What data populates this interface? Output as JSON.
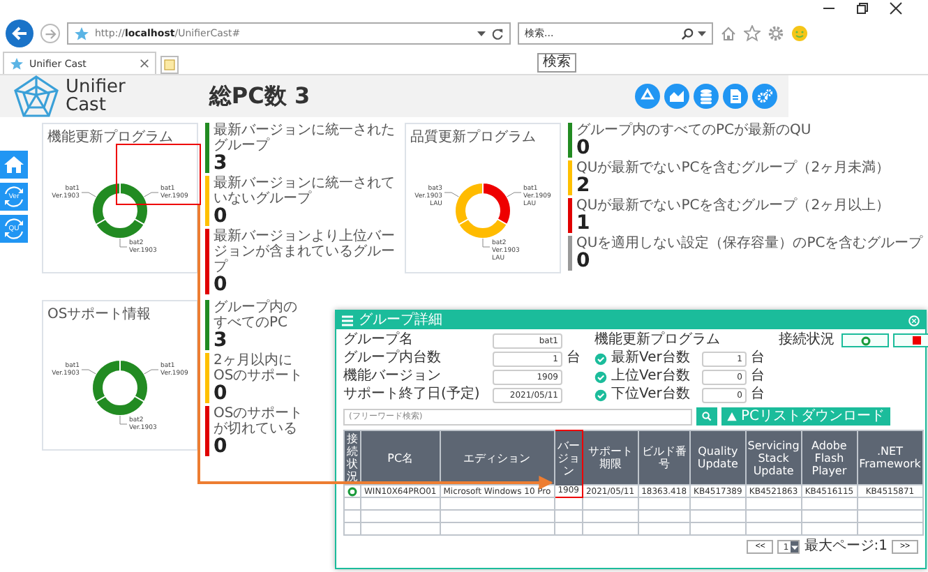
{
  "browser": {
    "url": "http://**localhost**/UnifierCast#",
    "search": {
      "value": "検索...",
      "tooltip": "検索"
    },
    "tabs": [
      {
        "label": "Unifier Cast",
        "selected": true
      }
    ]
  },
  "app": {
    "logo": [
      "Unifier",
      "Cast"
    ],
    "title": "総PC数 3"
  },
  "sidebar": {
    "items": [
      {
        "kind": "home"
      },
      {
        "kind": "cycle",
        "label": "Ver"
      },
      {
        "kind": "cycle",
        "label": "QU"
      }
    ]
  },
  "panels": [
    {
      "title": "機能更新プログラム",
      "highlighted": true,
      "slices": [
        {
          "color": "#228b22",
          "label": [
            "bat1",
            "Ver.1909"
          ]
        },
        {
          "color": "#228b22",
          "label": [
            "bat2",
            "Ver.1903"
          ]
        },
        {
          "color": "#228b22",
          "label": [
            "bat1",
            "Ver.1903"
          ]
        }
      ],
      "stats": [
        {
          "label": "最新バージョンに統一されたグループ",
          "value": "3",
          "color": "#228b22"
        },
        {
          "label": "最新バージョンに統一されていないグループ",
          "value": "0",
          "color": "#ffc000"
        },
        {
          "label": "最新バージョンより上位バージョンが含まれているグループ",
          "value": "0",
          "color": "#e00000"
        }
      ]
    },
    {
      "title": "品質更新プログラム",
      "highlighted": false,
      "slices": [
        {
          "color": "#ee0000",
          "label": [
            "bat1",
            "Ver.1909",
            "LAU"
          ]
        },
        {
          "color": "#ffbb00",
          "label": [
            "bat2",
            "Ver.1903",
            "LAU"
          ]
        },
        {
          "color": "#ffbb00",
          "label": [
            "bat3",
            "Ver.1903",
            "LAU"
          ]
        }
      ],
      "stats": [
        {
          "label": "グループ内のすべてのPCが最新のQU",
          "value": "0",
          "color": "#228b22"
        },
        {
          "label": "QUが最新でないPCを含むグループ（2ヶ月未満）",
          "value": "2",
          "color": "#ffc000"
        },
        {
          "label": "QUが最新でないPCを含むグループ（2ヶ月以上）",
          "value": "1",
          "color": "#e00000"
        },
        {
          "label": "QUを適用しない設定（保存容量）のPCを含むグループ",
          "value": "0",
          "color": "#999999"
        }
      ]
    },
    {
      "title": "OSサポート情報",
      "highlighted": false,
      "slices": [
        {
          "color": "#228b22",
          "label": [
            "bat1",
            "Ver.1909"
          ]
        },
        {
          "color": "#228b22",
          "label": [
            "bat2",
            "Ver.1903"
          ]
        },
        {
          "color": "#228b22",
          "label": [
            "bat1",
            "Ver.1903"
          ]
        }
      ],
      "stats": [
        {
          "label": "グループ内のすべてのPC",
          "value": "3",
          "color": "#228b22"
        },
        {
          "label": "2ヶ月以内にOSのサポート",
          "value": "0",
          "color": "#ffc000"
        },
        {
          "label": "OSのサポートが切れている",
          "value": "0",
          "color": "#e00000"
        }
      ]
    }
  ],
  "dialog": {
    "title": "グループ詳細",
    "fields": [
      {
        "label": "グループ名",
        "value": "bat1"
      },
      {
        "label": "グループ内台数",
        "value": "1",
        "unit": "台"
      },
      {
        "label": "機能バージョン",
        "value": "1909"
      },
      {
        "label": "サポート終了日(予定)",
        "value": "2021/05/11"
      }
    ],
    "program": {
      "title": "機能更新プログラム",
      "counts": [
        {
          "label": "最新Ver台数",
          "value": "1",
          "unit": "台"
        },
        {
          "label": "上位Ver台数",
          "value": "0",
          "unit": "台"
        },
        {
          "label": "下位Ver台数",
          "value": "0",
          "unit": "台"
        }
      ]
    },
    "connection": {
      "label": "接続状況",
      "toggles": [
        {
          "kind": "online"
        },
        {
          "kind": "offline"
        }
      ]
    },
    "search": {
      "placeholder": "(フリーワード検索)"
    },
    "download": "PCリストダウンロード",
    "table": {
      "columns": [
        {
          "label": "接続状況",
          "highlighted": false
        },
        {
          "label": "PC名",
          "highlighted": false
        },
        {
          "label": "エディション",
          "highlighted": false
        },
        {
          "label": "バージョン",
          "highlighted": true
        },
        {
          "label": "サポート期限",
          "highlighted": false
        },
        {
          "label": "ビルド番号",
          "highlighted": false
        },
        {
          "label": "Quality Update",
          "highlighted": false
        },
        {
          "label": "Servicing Stack Update",
          "highlighted": false
        },
        {
          "label": "Adobe Flash Player",
          "highlighted": false
        },
        {
          "label": ".NET Framework",
          "highlighted": false
        }
      ],
      "rows": [
        {
          "connected": true,
          "cells": [
            "",
            "WIN10X64PRO01",
            "Microsoft Windows 10 Pro",
            "1909",
            "2021/05/11",
            "18363.418",
            "KB4517389",
            "KB4521863",
            "KB4516115",
            "KB4515871"
          ]
        }
      ]
    },
    "pager": {
      "first": "<<",
      "page": "1",
      "info": "最大ページ:1",
      "last": ">>"
    }
  }
}
